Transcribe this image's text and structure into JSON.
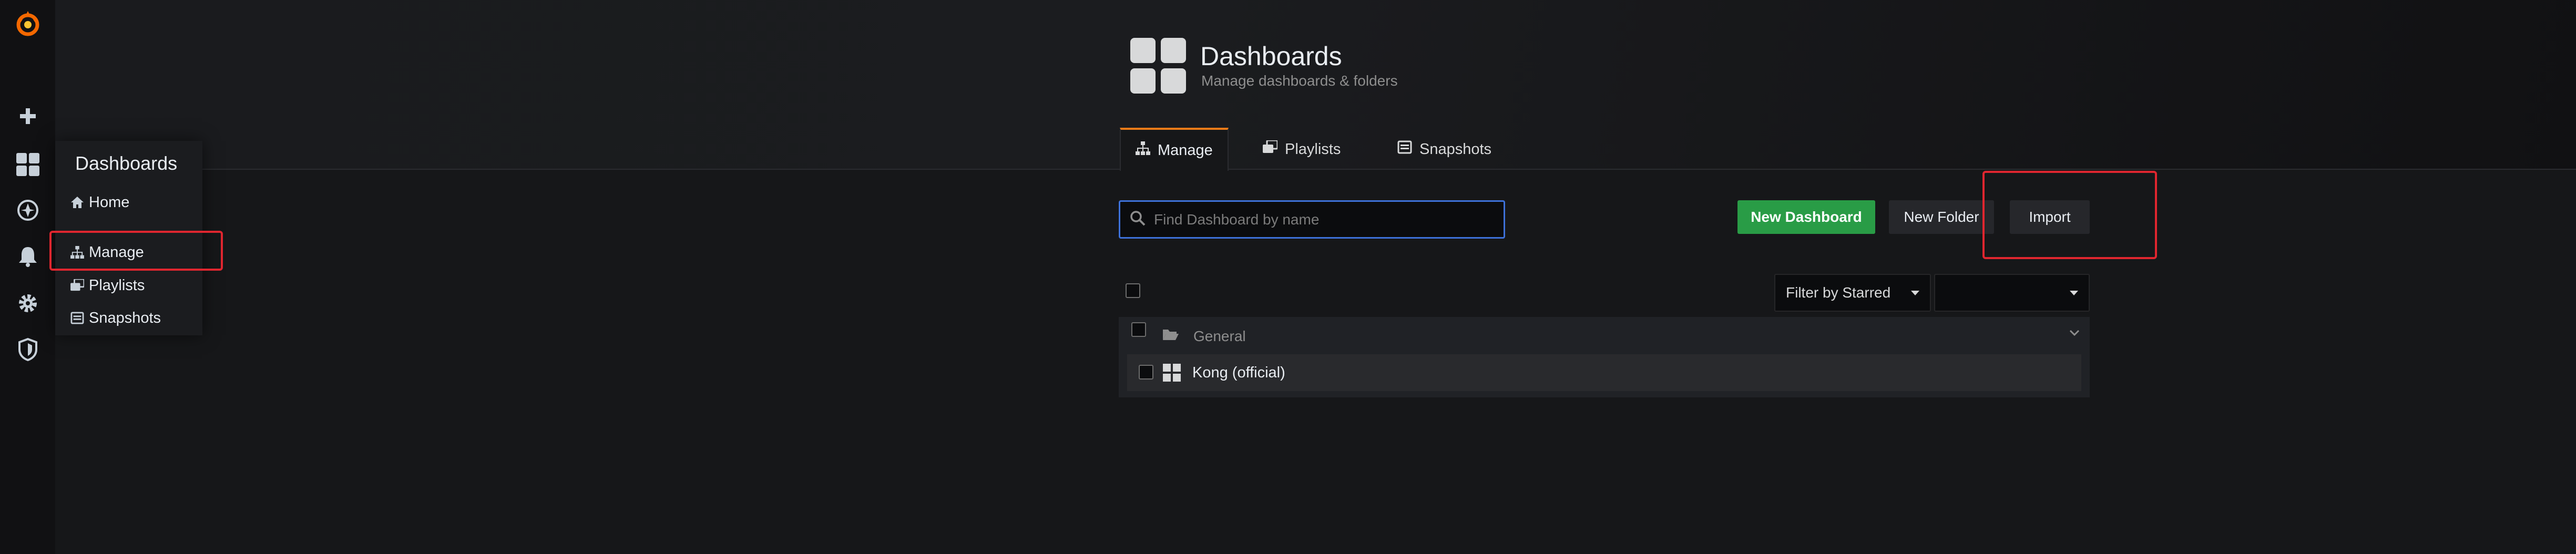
{
  "sidemenu": {
    "icons": [
      "grafana-logo-icon",
      "plus-icon",
      "dashboards-icon",
      "explore-icon",
      "bell-icon",
      "gear-icon",
      "shield-icon"
    ]
  },
  "flyout": {
    "title": "Dashboards",
    "items": [
      {
        "label": "Home",
        "icon": "home-icon"
      },
      {
        "label": "Manage",
        "icon": "sitemap-icon"
      },
      {
        "label": "Playlists",
        "icon": "playlist-icon"
      },
      {
        "label": "Snapshots",
        "icon": "snapshot-icon"
      }
    ]
  },
  "header": {
    "title": "Dashboards",
    "subtitle": "Manage dashboards & folders",
    "tabs": [
      {
        "label": "Manage",
        "icon": "sitemap-icon",
        "active": true
      },
      {
        "label": "Playlists",
        "icon": "playlist-icon",
        "active": false
      },
      {
        "label": "Snapshots",
        "icon": "snapshot-icon",
        "active": false
      }
    ]
  },
  "toolbar": {
    "search_placeholder": "Find Dashboard by name",
    "new_dashboard_label": "New Dashboard",
    "new_folder_label": "New Folder",
    "import_label": "Import"
  },
  "filters": {
    "starred_label": "Filter by Starred",
    "tag_label": ""
  },
  "list": {
    "folder_name": "General",
    "dashboards": [
      {
        "title": "Kong (official)"
      }
    ]
  },
  "colors": {
    "accent": "#eb7b18",
    "primary_button": "#299c46",
    "highlight_box": "#e0262f",
    "search_focus": "#3d71d9"
  }
}
